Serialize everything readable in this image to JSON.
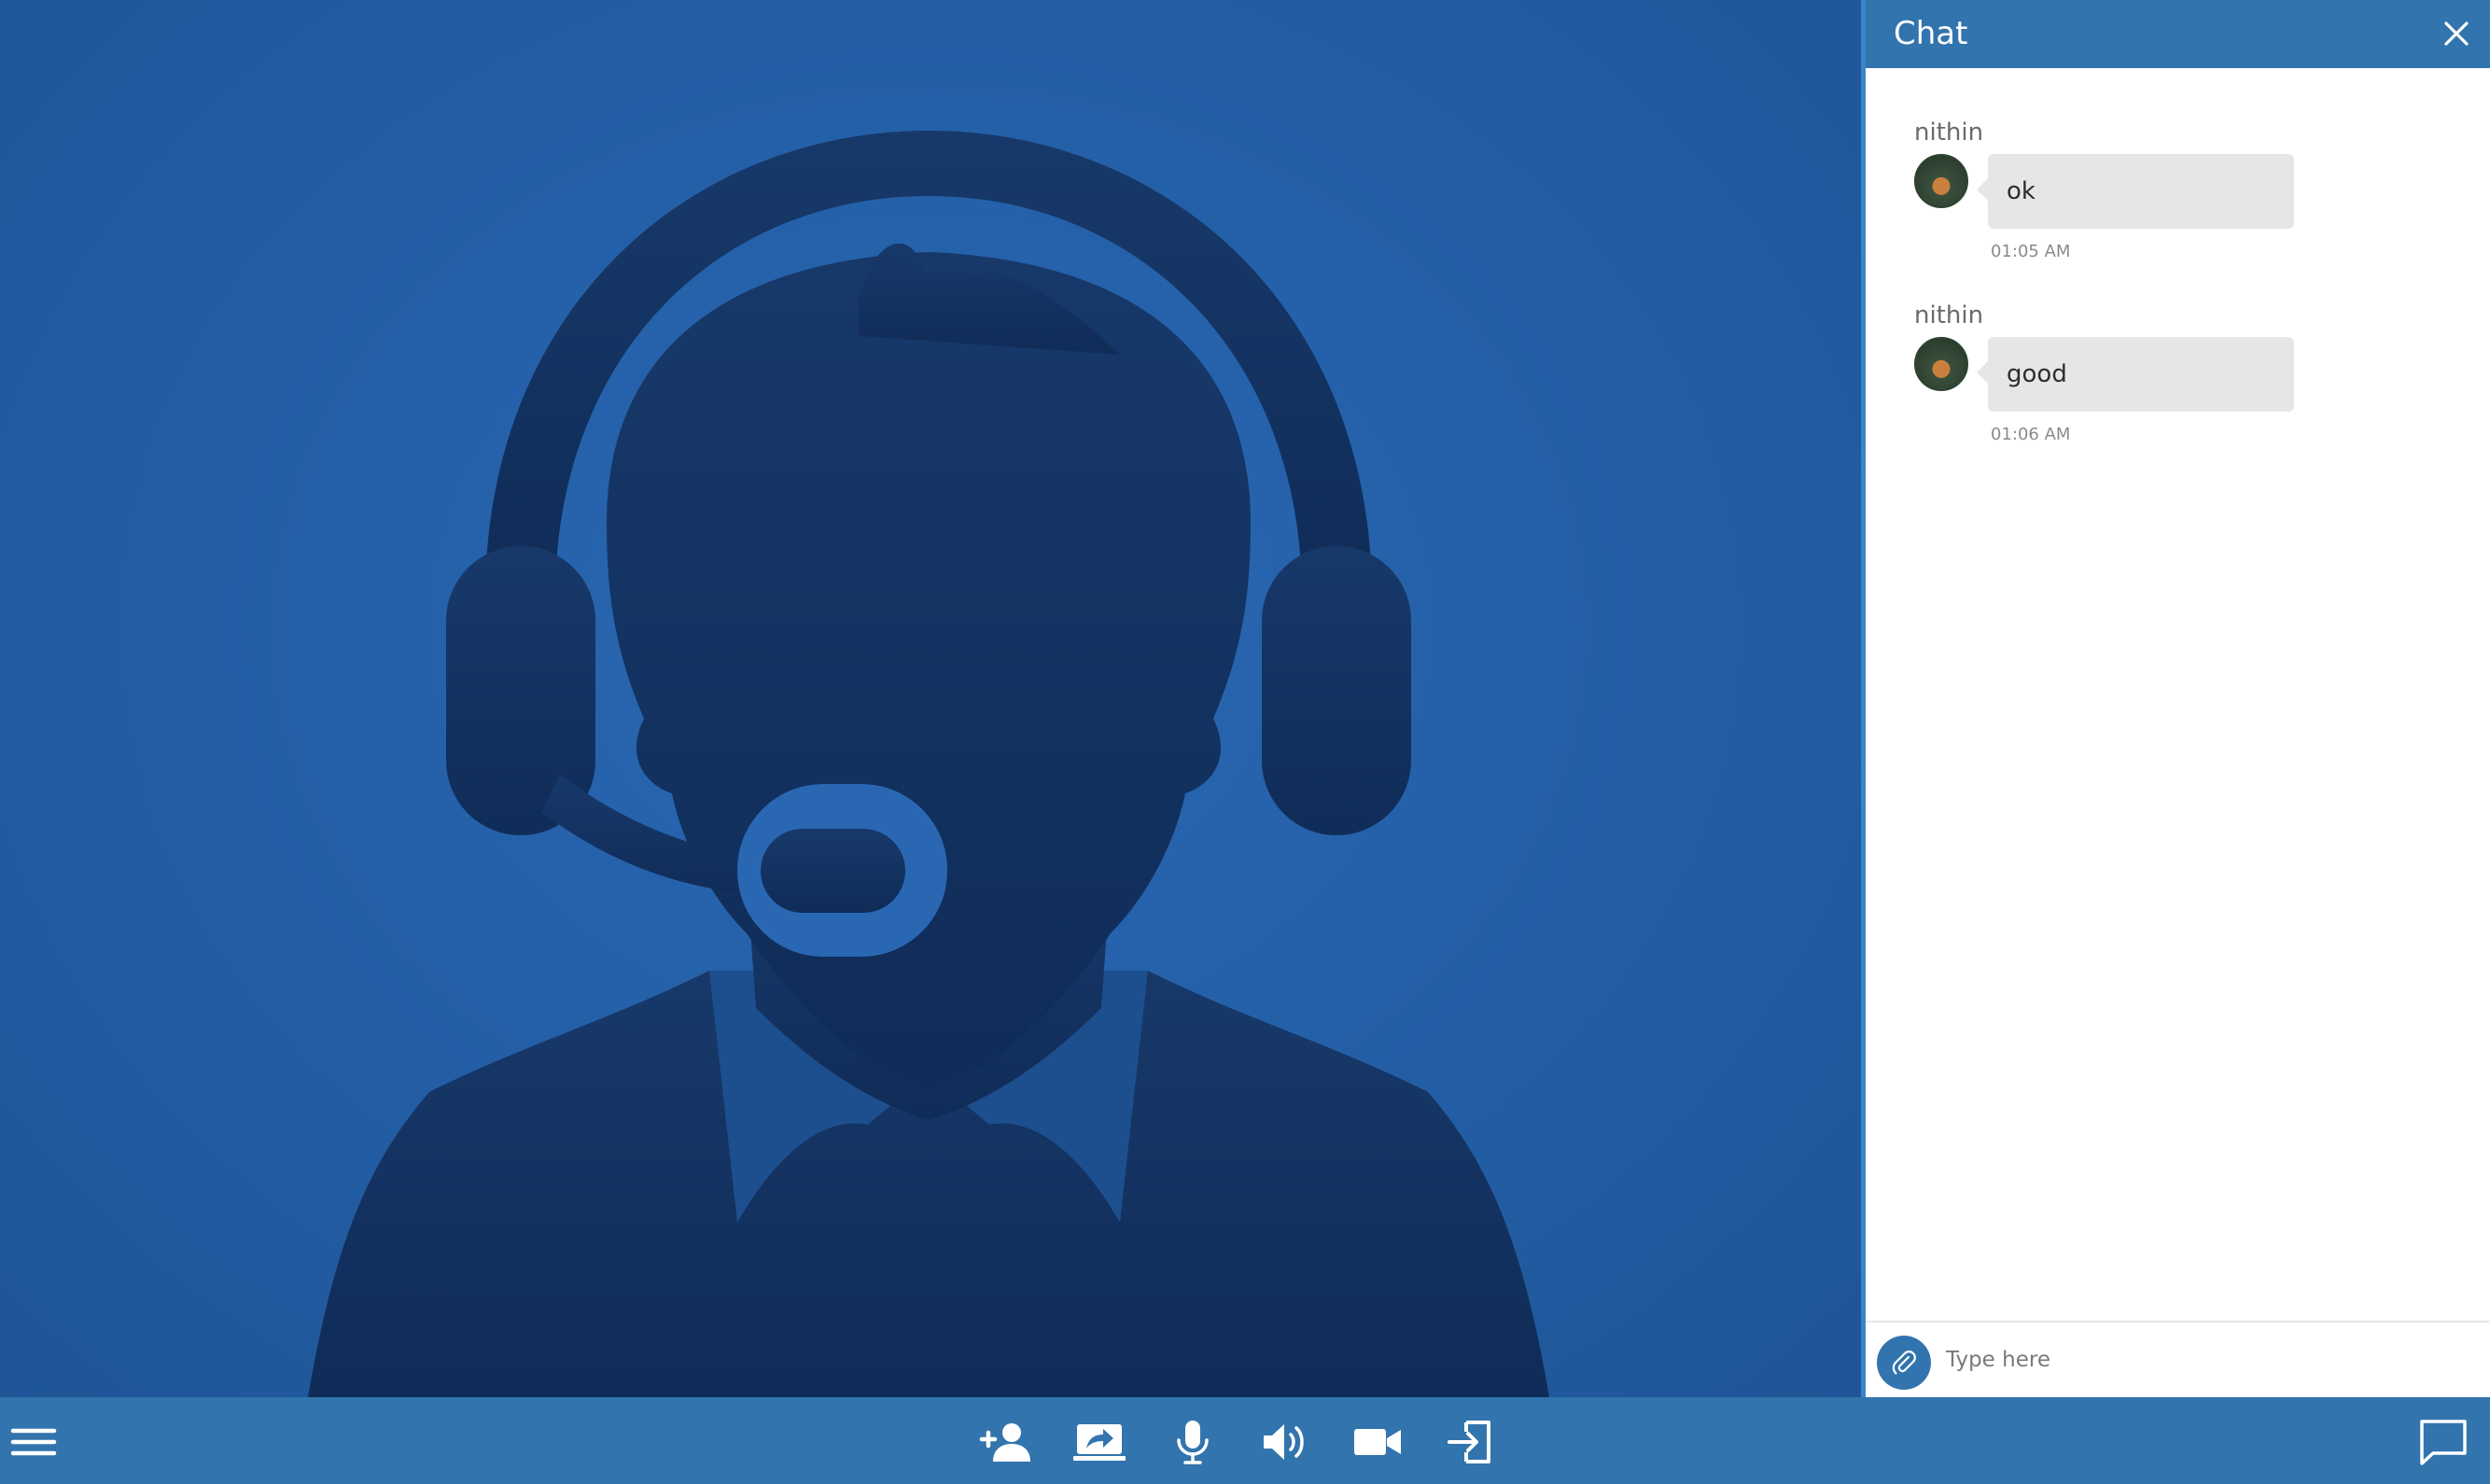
{
  "chat": {
    "title": "Chat",
    "messages": [
      {
        "sender": "nithin",
        "text": "ok",
        "time": "01:05 AM"
      },
      {
        "sender": "nithin",
        "text": "good",
        "time": "01:06 AM"
      }
    ],
    "input_placeholder": "Type here"
  },
  "toolbar": {
    "buttons": [
      {
        "icon": "menu-icon"
      },
      {
        "icon": "add-user-icon"
      },
      {
        "icon": "share-screen-icon"
      },
      {
        "icon": "microphone-icon"
      },
      {
        "icon": "speaker-icon"
      },
      {
        "icon": "video-camera-icon"
      },
      {
        "icon": "exit-icon"
      },
      {
        "icon": "chat-icon"
      }
    ]
  },
  "colors": {
    "toolbar": "#3274ad",
    "video_background": "#2460a8",
    "silhouette": "#163a6c",
    "chat_bubble": "#e7e6e4"
  }
}
